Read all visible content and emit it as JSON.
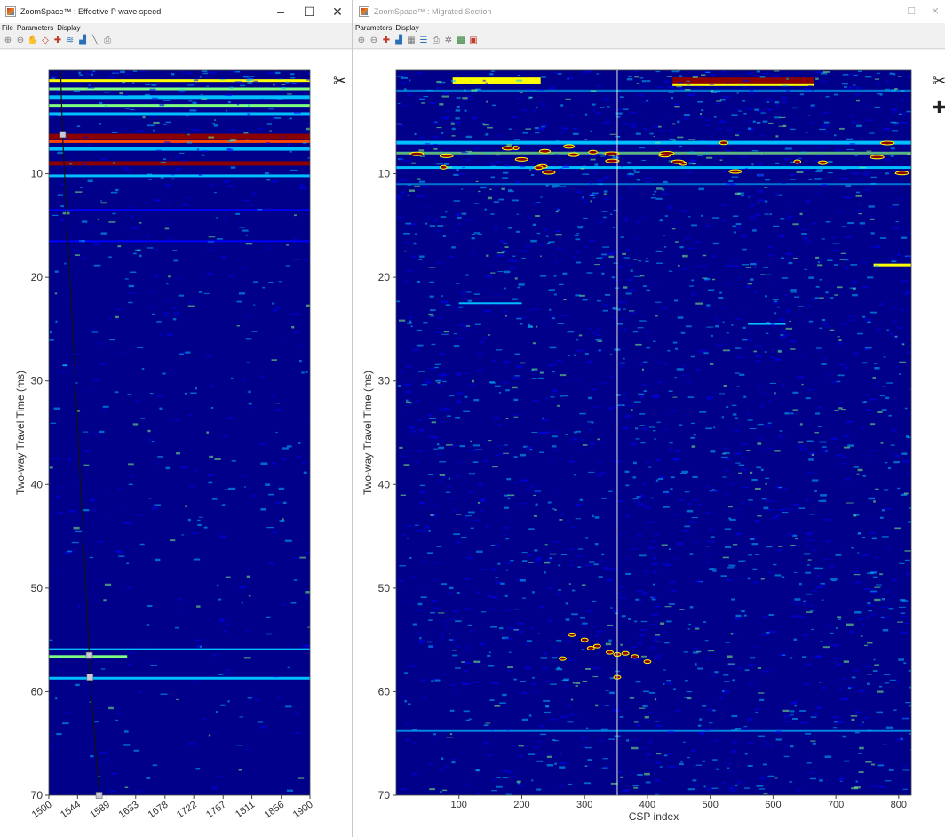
{
  "left_window": {
    "title": "ZoomSpace™ : Effective P wave speed",
    "menu": [
      "File",
      "Parameters",
      "Display"
    ],
    "toolbar_icons": [
      "zoom-in-icon",
      "zoom-out-icon",
      "pan-icon",
      "eraser-icon",
      "pick-icon",
      "layers-icon",
      "chart-icon",
      "lines-icon",
      "print-icon"
    ],
    "controls": {
      "minimize": "–",
      "maximize": "☐",
      "close": "✕"
    }
  },
  "right_window": {
    "title": "ZoomSpace™ : Migrated Section",
    "menu": [
      "Parameters",
      "Display"
    ],
    "toolbar_icons": [
      "zoom-in-icon",
      "zoom-out-icon",
      "pick-icon",
      "chart-icon",
      "grid-icon",
      "stack-icon",
      "print-icon",
      "star-icon",
      "color-map-icon",
      "palette-icon"
    ],
    "controls": {
      "maximize": "☐",
      "close": "✕"
    }
  },
  "chart_data": [
    {
      "type": "heatmap",
      "ylabel": "Two-way Travel Time (ms)",
      "xlabel": "",
      "x_ticks": [
        "1500",
        "1544",
        "1589",
        "1633",
        "1678",
        "1722",
        "1767",
        "1811",
        "1856",
        "1900"
      ],
      "y_ticks": [
        10,
        20,
        30,
        40,
        50,
        60,
        70
      ],
      "xlim": [
        1500,
        1900
      ],
      "ylim": [
        0,
        70
      ],
      "colormap": [
        "#00008b",
        "#0000ff",
        "#00bfff",
        "#7fff7f",
        "#ffff00",
        "#ff4500",
        "#8b0000"
      ],
      "velocity_picks": [
        {
          "x": 1521,
          "y": 6.2
        },
        {
          "x": 1562,
          "y": 56.5
        },
        {
          "x": 1563,
          "y": 58.6
        },
        {
          "x": 1577,
          "y": 70
        }
      ]
    },
    {
      "type": "heatmap",
      "ylabel": "Two-way Travel Time (ms)",
      "xlabel": "CSP index",
      "x_ticks": [
        100,
        200,
        300,
        400,
        500,
        600,
        700,
        800
      ],
      "y_ticks": [
        10,
        20,
        30,
        40,
        50,
        60,
        70
      ],
      "xlim": [
        0,
        820
      ],
      "ylim": [
        0,
        70
      ],
      "cursor_x": 352,
      "colormap": [
        "#00008b",
        "#0000ff",
        "#00bfff",
        "#7fff7f",
        "#ffff00",
        "#ff4500",
        "#8b0000"
      ]
    }
  ]
}
